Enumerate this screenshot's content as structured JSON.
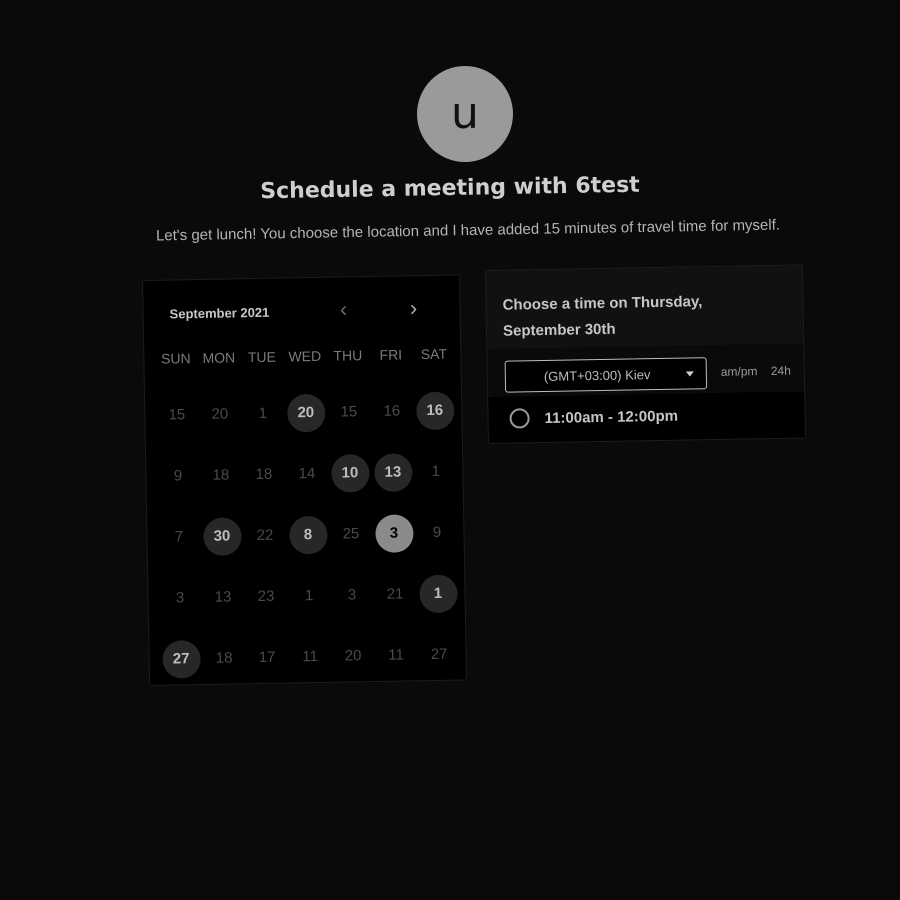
{
  "host": {
    "avatar_initial": "u",
    "title": "Schedule a meeting with 6test",
    "description": "Let's get lunch! You choose the location and I have added 15 minutes of travel time for myself."
  },
  "calendar": {
    "month_label": "September 2021",
    "prev_glyph": "‹",
    "next_glyph": "›",
    "weekdays": [
      "SUN",
      "MON",
      "TUE",
      "WED",
      "THU",
      "FRI",
      "SAT"
    ],
    "weeks": [
      [
        {
          "n": "15"
        },
        {
          "n": "20"
        },
        {
          "n": "1"
        },
        {
          "n": "20",
          "available": true
        },
        {
          "n": "15"
        },
        {
          "n": "16"
        },
        {
          "n": "16",
          "available": true
        }
      ],
      [
        {
          "n": "9"
        },
        {
          "n": "18"
        },
        {
          "n": "18"
        },
        {
          "n": "14"
        },
        {
          "n": "10",
          "available": true
        },
        {
          "n": "13",
          "available": true
        },
        {
          "n": "1"
        }
      ],
      [
        {
          "n": "7"
        },
        {
          "n": "30",
          "available": true
        },
        {
          "n": "22"
        },
        {
          "n": "8",
          "available": true
        },
        {
          "n": "25"
        },
        {
          "n": "3",
          "selected": true
        },
        {
          "n": "9"
        }
      ],
      [
        {
          "n": "3"
        },
        {
          "n": "13"
        },
        {
          "n": "23"
        },
        {
          "n": "1"
        },
        {
          "n": "3"
        },
        {
          "n": "21"
        },
        {
          "n": "1",
          "available": true
        }
      ],
      [
        {
          "n": "27",
          "available": true
        },
        {
          "n": "18"
        },
        {
          "n": "17"
        },
        {
          "n": "11"
        },
        {
          "n": "20"
        },
        {
          "n": "11"
        },
        {
          "n": "27"
        }
      ]
    ]
  },
  "time_panel": {
    "heading": "Choose a time on Thursday, September 30th",
    "timezone": "(GMT+03:00) Kiev",
    "format_ampm": "am/pm",
    "format_24h": "24h",
    "slots": [
      "11:00am - 12:00pm"
    ]
  },
  "colors": {
    "background": "#0a0a0a",
    "available_day": "#272727",
    "selected_day": "#8a8a8a"
  }
}
